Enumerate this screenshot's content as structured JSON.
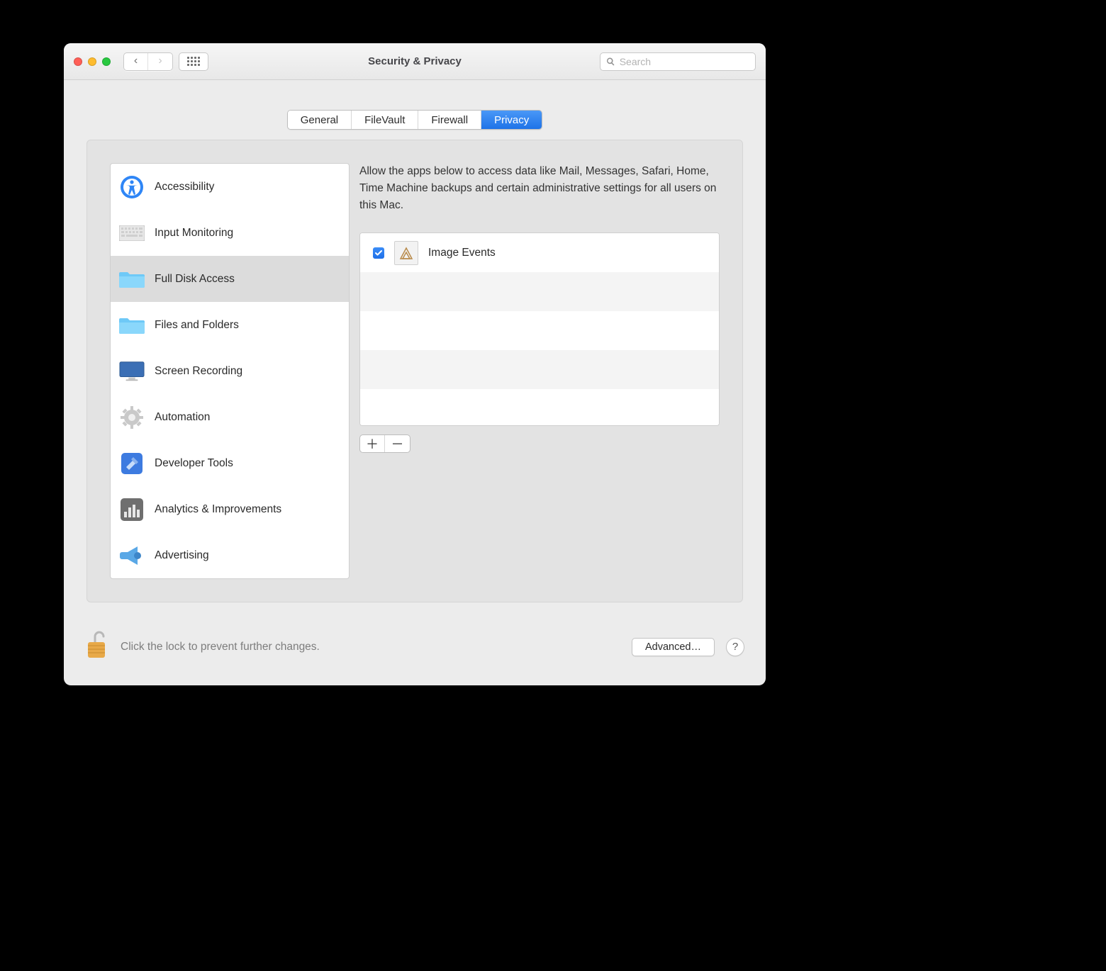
{
  "window": {
    "title": "Security & Privacy",
    "search_placeholder": "Search"
  },
  "tabs": {
    "items": [
      {
        "label": "General",
        "active": false
      },
      {
        "label": "FileVault",
        "active": false
      },
      {
        "label": "Firewall",
        "active": false
      },
      {
        "label": "Privacy",
        "active": true
      }
    ]
  },
  "sidebar": {
    "items": [
      {
        "label": "Accessibility",
        "icon": "accessibility-icon",
        "selected": false
      },
      {
        "label": "Input Monitoring",
        "icon": "keyboard-icon",
        "selected": false
      },
      {
        "label": "Full Disk Access",
        "icon": "folder-icon",
        "selected": true
      },
      {
        "label": "Files and Folders",
        "icon": "folder-icon",
        "selected": false
      },
      {
        "label": "Screen Recording",
        "icon": "display-icon",
        "selected": false
      },
      {
        "label": "Automation",
        "icon": "gear-icon",
        "selected": false
      },
      {
        "label": "Developer Tools",
        "icon": "hammer-icon",
        "selected": false
      },
      {
        "label": "Analytics & Improvements",
        "icon": "chart-icon",
        "selected": false
      },
      {
        "label": "Advertising",
        "icon": "megaphone-icon",
        "selected": false
      }
    ]
  },
  "detail": {
    "description": "Allow the apps below to access data like Mail, Messages, Safari, Home, Time Machine backups and certain administrative settings for all users on this Mac.",
    "apps": [
      {
        "label": "Image Events",
        "checked": true
      }
    ]
  },
  "footer": {
    "lock_message": "Click the lock to prevent further changes.",
    "advanced_label": "Advanced…",
    "help_label": "?"
  }
}
